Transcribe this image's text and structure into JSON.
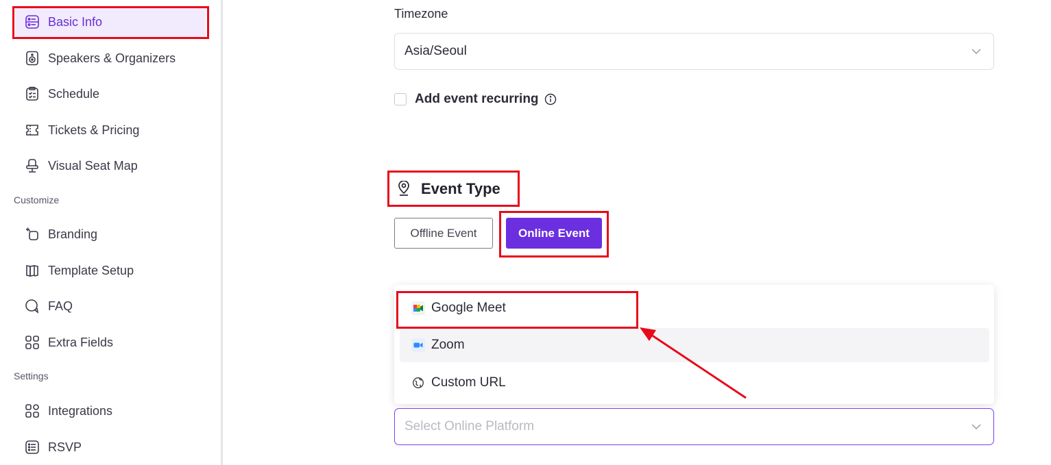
{
  "sidebar": {
    "items": [
      {
        "label": "Basic Info",
        "icon": "basic-info-icon",
        "active": true
      },
      {
        "label": "Speakers & Organizers",
        "icon": "speaker-icon"
      },
      {
        "label": "Schedule",
        "icon": "clipboard-icon"
      },
      {
        "label": "Tickets & Pricing",
        "icon": "ticket-icon"
      },
      {
        "label": "Visual Seat Map",
        "icon": "seat-icon"
      }
    ],
    "customize_label": "Customize",
    "customize_items": [
      {
        "label": "Branding",
        "icon": "branding-icon"
      },
      {
        "label": "Template Setup",
        "icon": "template-icon"
      },
      {
        "label": "FAQ",
        "icon": "faq-icon"
      },
      {
        "label": "Extra Fields",
        "icon": "extra-fields-icon"
      }
    ],
    "settings_label": "Settings",
    "settings_items": [
      {
        "label": "Integrations",
        "icon": "integrations-icon"
      },
      {
        "label": "RSVP",
        "icon": "rsvp-icon"
      }
    ]
  },
  "main": {
    "timezone_label": "Timezone",
    "timezone_value": "Asia/Seoul",
    "recurring_label": "Add event recurring",
    "event_type_title": "Event Type",
    "offline_button": "Offline Event",
    "online_button": "Online Event",
    "platform_options": [
      {
        "label": "Google Meet",
        "icon": "google-meet-icon"
      },
      {
        "label": "Zoom",
        "icon": "zoom-icon"
      },
      {
        "label": "Custom URL",
        "icon": "custom-url-icon"
      }
    ],
    "platform_placeholder": "Select Online Platform"
  },
  "colors": {
    "accent": "#6b2fe0",
    "highlight": "#e8091a",
    "active_bg": "#f1ebfd"
  }
}
